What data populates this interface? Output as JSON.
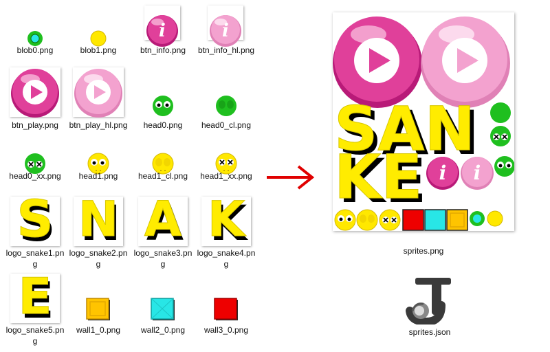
{
  "files": [
    {
      "id": "blob0",
      "label": "blob0.png"
    },
    {
      "id": "blob1",
      "label": "blob1.png"
    },
    {
      "id": "btn_info",
      "label": "btn_info.png"
    },
    {
      "id": "btn_info_hl",
      "label": "btn_info_hl.png"
    },
    {
      "id": "btn_play",
      "label": "btn_play.png"
    },
    {
      "id": "btn_play_hl",
      "label": "btn_play_hl.png"
    },
    {
      "id": "head0",
      "label": "head0.png"
    },
    {
      "id": "head0_cl",
      "label": "head0_cl.png"
    },
    {
      "id": "head0_xx",
      "label": "head0_xx.png"
    },
    {
      "id": "head1",
      "label": "head1.png"
    },
    {
      "id": "head1_cl",
      "label": "head1_cl.png"
    },
    {
      "id": "head1_xx",
      "label": "head1_xx.png"
    },
    {
      "id": "logo_snake1",
      "label": "logo_snake1.png",
      "letter": "S"
    },
    {
      "id": "logo_snake2",
      "label": "logo_snake2.png",
      "letter": "N"
    },
    {
      "id": "logo_snake3",
      "label": "logo_snake3.png",
      "letter": "A"
    },
    {
      "id": "logo_snake4",
      "label": "logo_snake4.png",
      "letter": "K"
    },
    {
      "id": "logo_snake5",
      "label": "logo_snake5.png",
      "letter": "E"
    },
    {
      "id": "wall1_0",
      "label": "wall1_0.png"
    },
    {
      "id": "wall2_0",
      "label": "wall2_0.png"
    },
    {
      "id": "wall3_0",
      "label": "wall3_0.png"
    }
  ],
  "sprite_sheet": {
    "label": "sprites.png",
    "logo_line1": "SAN",
    "logo_line2": "KE",
    "info_glyph": "i"
  },
  "json_file": {
    "label": "sprites.json"
  },
  "colors": {
    "pink": "#e0409a",
    "pink_light": "#f3a2cf",
    "green": "#1fbf1f",
    "yellow": "#ffe800",
    "red": "#ee0000",
    "cyan": "#28e6e6",
    "orange": "#ffc400",
    "arrow": "#e00000"
  },
  "glyphs": {
    "info": "i",
    "xx": "✕✕"
  }
}
